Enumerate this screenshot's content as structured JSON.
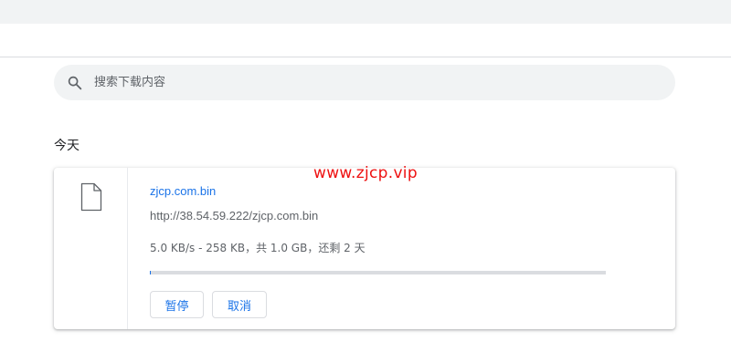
{
  "search": {
    "placeholder": "搜索下载内容",
    "icon": "search-icon"
  },
  "section": {
    "heading": "今天"
  },
  "download": {
    "file_name": "zjcp.com.bin",
    "url": "http://38.54.59.222/zjcp.com.bin",
    "status": "5.0 KB/s - 258 KB，共 1.0 GB，还剩 2 天",
    "progress": 0.0003,
    "icon": "file-icon",
    "watermark": "www.zjcp.vip",
    "pause_label": "暂停",
    "cancel_label": "取消"
  },
  "colors": {
    "accent": "#1a73e8",
    "watermark": "#ee1111",
    "background": "#ffffff",
    "toolbar": "#f1f3f4"
  }
}
